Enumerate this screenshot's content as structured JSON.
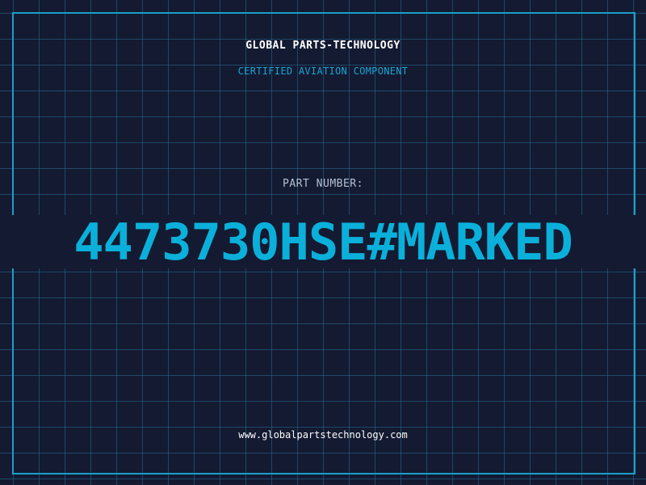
{
  "brand": "GLOBAL PARTS-TECHNOLOGY",
  "subtitle": "CERTIFIED AVIATION COMPONENT",
  "part_label": "PART NUMBER:",
  "part_number": "4473730HSE#MARKED",
  "website": "www.globalpartstechnology.com",
  "colors": {
    "background": "#131a31",
    "grid": "#266e96",
    "accent": "#0ab0da",
    "text": "#ffffff",
    "muted": "#b6c1d2"
  }
}
